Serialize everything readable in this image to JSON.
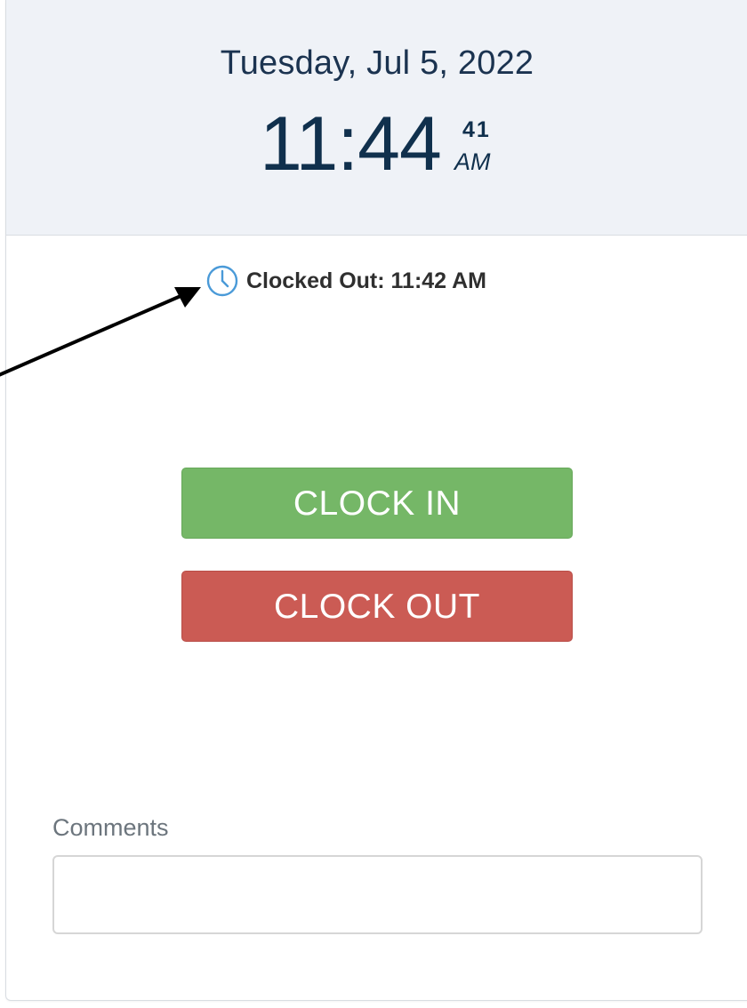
{
  "header": {
    "date": "Tuesday, Jul 5, 2022",
    "time": "11:44",
    "seconds": "41",
    "ampm": "AM"
  },
  "status": {
    "icon": "clock-icon",
    "text": "Clocked Out: 11:42 AM"
  },
  "actions": {
    "clock_in_label": "CLOCK IN",
    "clock_out_label": "CLOCK OUT"
  },
  "comments": {
    "label": "Comments",
    "value": "",
    "placeholder": ""
  },
  "annotation": {
    "icon": "arrow-icon"
  },
  "colors": {
    "header_bg": "#eff2f7",
    "clock_in": "#75b767",
    "clock_out": "#cb5b54",
    "text_dark": "#10304d",
    "icon_blue": "#4a9ad8"
  }
}
